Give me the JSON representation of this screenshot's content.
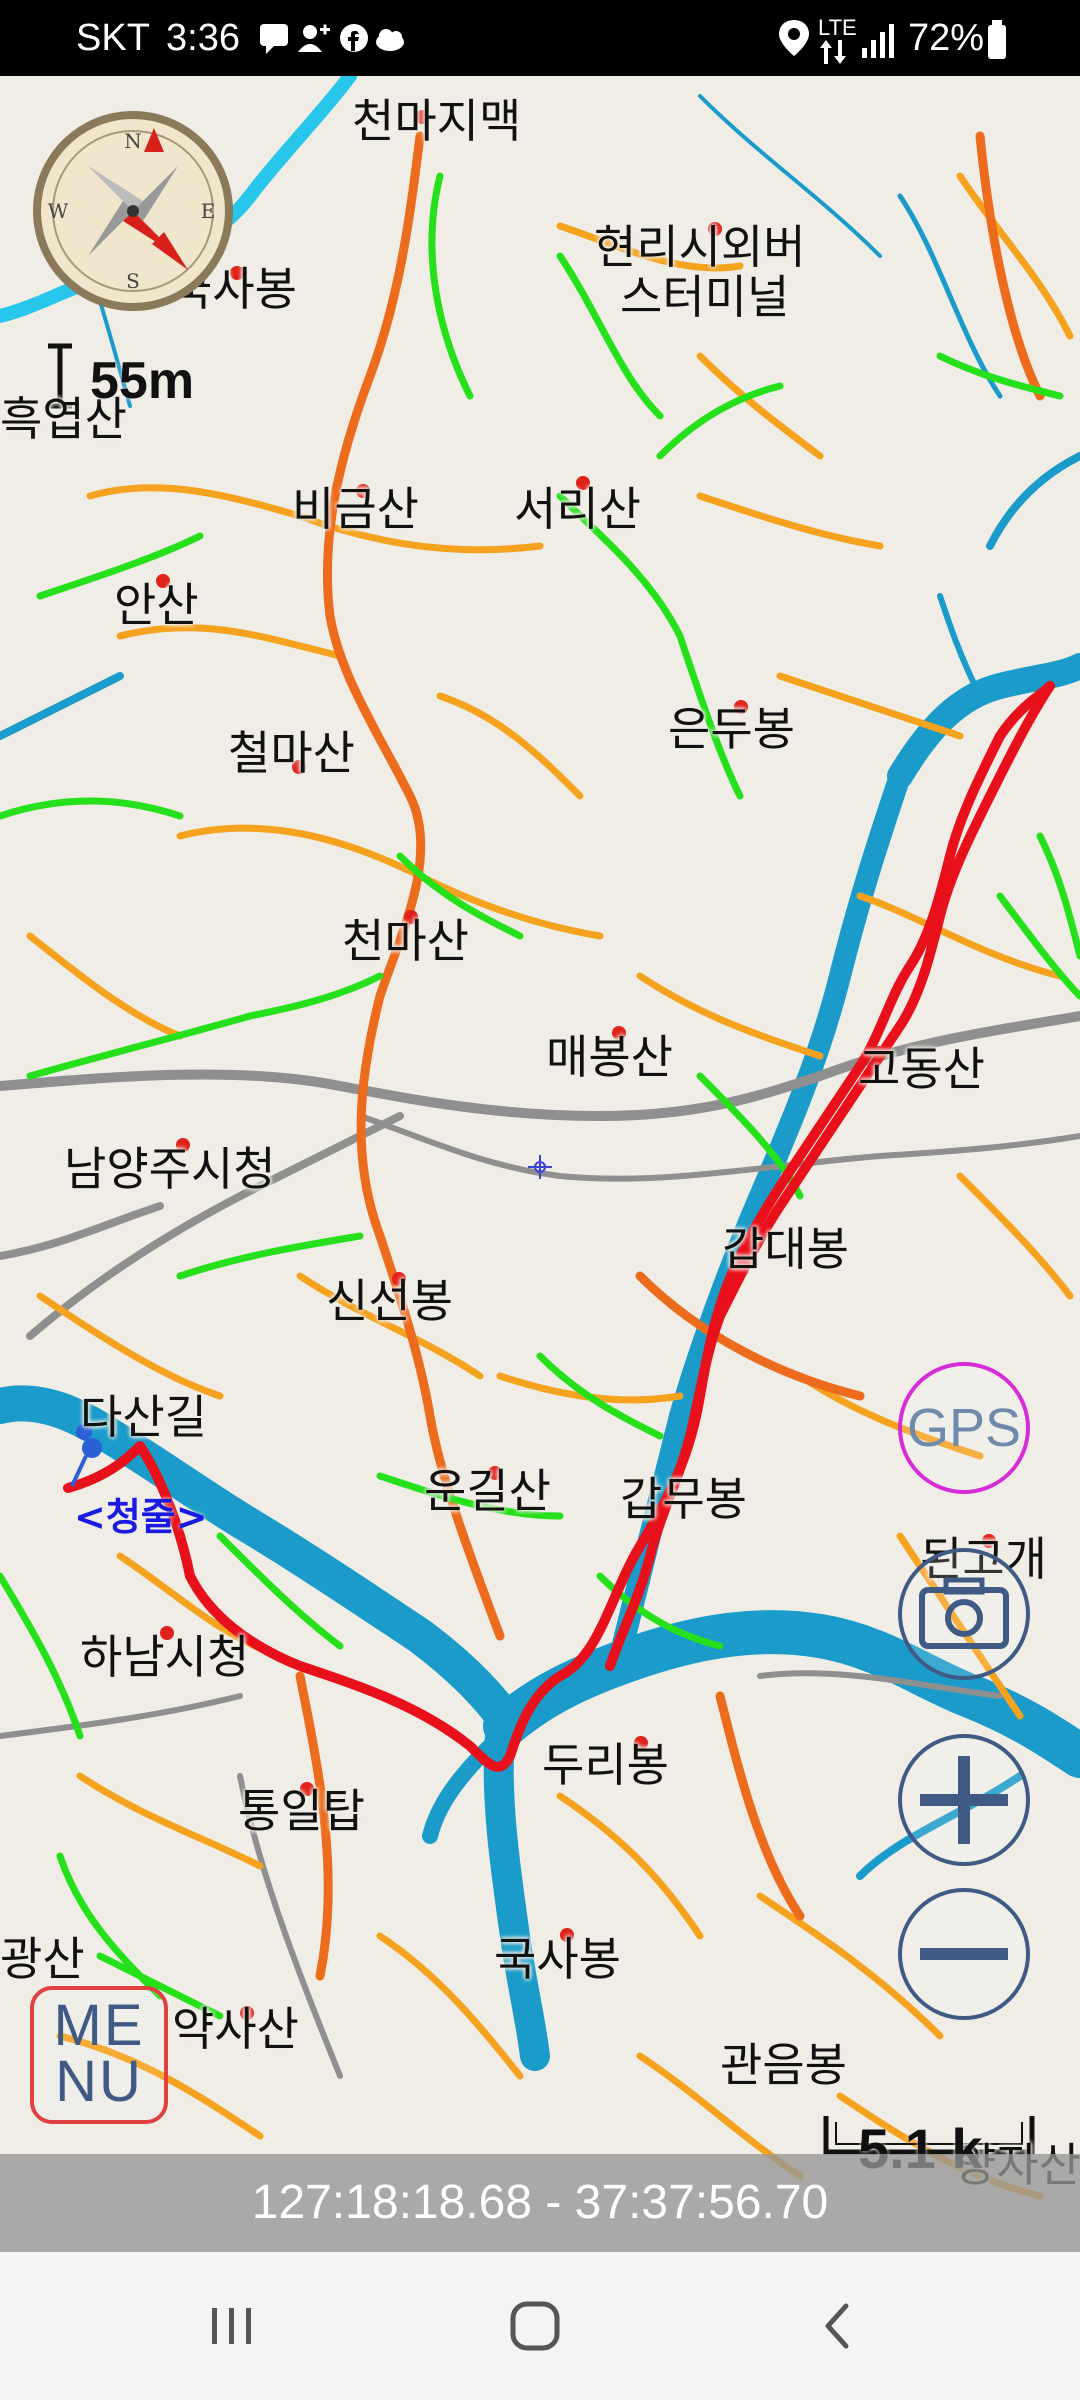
{
  "status_bar": {
    "carrier": "SKT",
    "time": "3:36",
    "network": "LTE",
    "battery": "72%",
    "left_icons": [
      "message-icon",
      "person-add-icon",
      "facebook-icon",
      "cloud-icon"
    ],
    "right_icons": [
      "location-icon",
      "lte-icon",
      "signal-icon",
      "battery-icon"
    ]
  },
  "map": {
    "places": [
      "천마지맥",
      "현리시외버",
      "스터미널",
      "국사봉",
      "흑엽산",
      "비금산",
      "서리산",
      "안산",
      "철마산",
      "은두봉",
      "천마산",
      "매봉산",
      "고동산",
      "남양주시청",
      "갑대봉",
      "신선봉",
      "다산길",
      "운길산",
      "갑무봉",
      "된고개",
      "하남시청",
      "두리봉",
      "통일탑",
      "국사봉",
      "광산",
      "약사산",
      "관음봉",
      "양자산"
    ],
    "start_label": "<청줄>",
    "scale_left": "55m",
    "scale_right": "5.1 k",
    "track_color": "#e8101a",
    "river_color": "#1a9bc9"
  },
  "controls": {
    "gps_label": "GPS",
    "menu_label_top": "ME",
    "menu_label_bottom": "NU",
    "camera": "camera-icon",
    "zoom_in": "plus-icon",
    "zoom_out": "minus-icon",
    "compass": "compass-icon"
  },
  "coordinates": "127:18:18.68 - 37:37:56.70",
  "nav_bar": {
    "recents": "recents-icon",
    "home": "home-icon",
    "back": "back-icon"
  }
}
